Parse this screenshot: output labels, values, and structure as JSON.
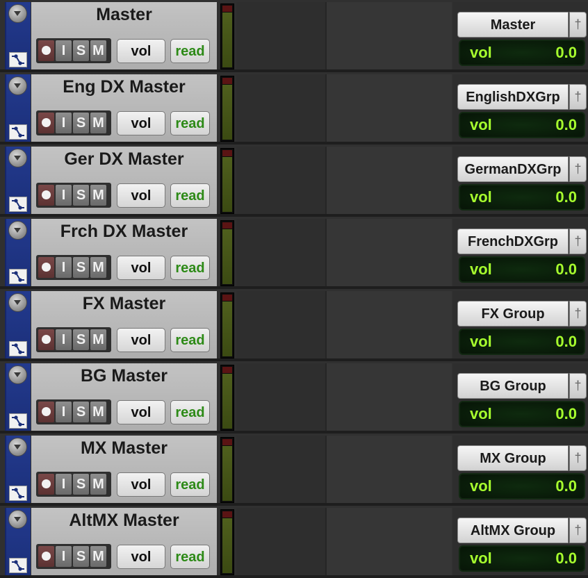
{
  "tracks": [
    {
      "name": "Master",
      "group": "Master",
      "buttons": {
        "rec": "",
        "input": "I",
        "solo": "S",
        "mute": "M"
      },
      "automation_view": "vol",
      "automation_mode": "read",
      "display": {
        "label": "vol",
        "value": "0.0"
      }
    },
    {
      "name": "Eng DX Master",
      "group": "EnglishDXGrp",
      "buttons": {
        "rec": "",
        "input": "I",
        "solo": "S",
        "mute": "M"
      },
      "automation_view": "vol",
      "automation_mode": "read",
      "display": {
        "label": "vol",
        "value": "0.0"
      }
    },
    {
      "name": "Ger DX Master",
      "group": "GermanDXGrp",
      "buttons": {
        "rec": "",
        "input": "I",
        "solo": "S",
        "mute": "M"
      },
      "automation_view": "vol",
      "automation_mode": "read",
      "display": {
        "label": "vol",
        "value": "0.0"
      }
    },
    {
      "name": "Frch DX Master",
      "group": "FrenchDXGrp",
      "buttons": {
        "rec": "",
        "input": "I",
        "solo": "S",
        "mute": "M"
      },
      "automation_view": "vol",
      "automation_mode": "read",
      "display": {
        "label": "vol",
        "value": "0.0"
      }
    },
    {
      "name": "FX Master",
      "group": "FX Group",
      "buttons": {
        "rec": "",
        "input": "I",
        "solo": "S",
        "mute": "M"
      },
      "automation_view": "vol",
      "automation_mode": "read",
      "display": {
        "label": "vol",
        "value": "0.0"
      }
    },
    {
      "name": "BG Master",
      "group": "BG Group",
      "buttons": {
        "rec": "",
        "input": "I",
        "solo": "S",
        "mute": "M"
      },
      "automation_view": "vol",
      "automation_mode": "read",
      "display": {
        "label": "vol",
        "value": "0.0"
      }
    },
    {
      "name": "MX Master",
      "group": "MX Group",
      "buttons": {
        "rec": "",
        "input": "I",
        "solo": "S",
        "mute": "M"
      },
      "automation_view": "vol",
      "automation_mode": "read",
      "display": {
        "label": "vol",
        "value": "0.0"
      }
    },
    {
      "name": "AltMX Master",
      "group": "AltMX Group",
      "buttons": {
        "rec": "",
        "input": "I",
        "solo": "S",
        "mute": "M"
      },
      "automation_view": "vol",
      "automation_mode": "read",
      "display": {
        "label": "vol",
        "value": "0.0"
      }
    }
  ],
  "icons": {
    "collapse": "chevron-down-icon",
    "automation": "automation-curve-icon",
    "pin": "pin-icon",
    "record": "record-dot-icon"
  },
  "colors": {
    "track_color_strip": "#233a8e",
    "read_mode": "#2d8a17",
    "display_text": "#a7ff2e",
    "display_bg": "#071507",
    "record_button": "#7a4848"
  }
}
